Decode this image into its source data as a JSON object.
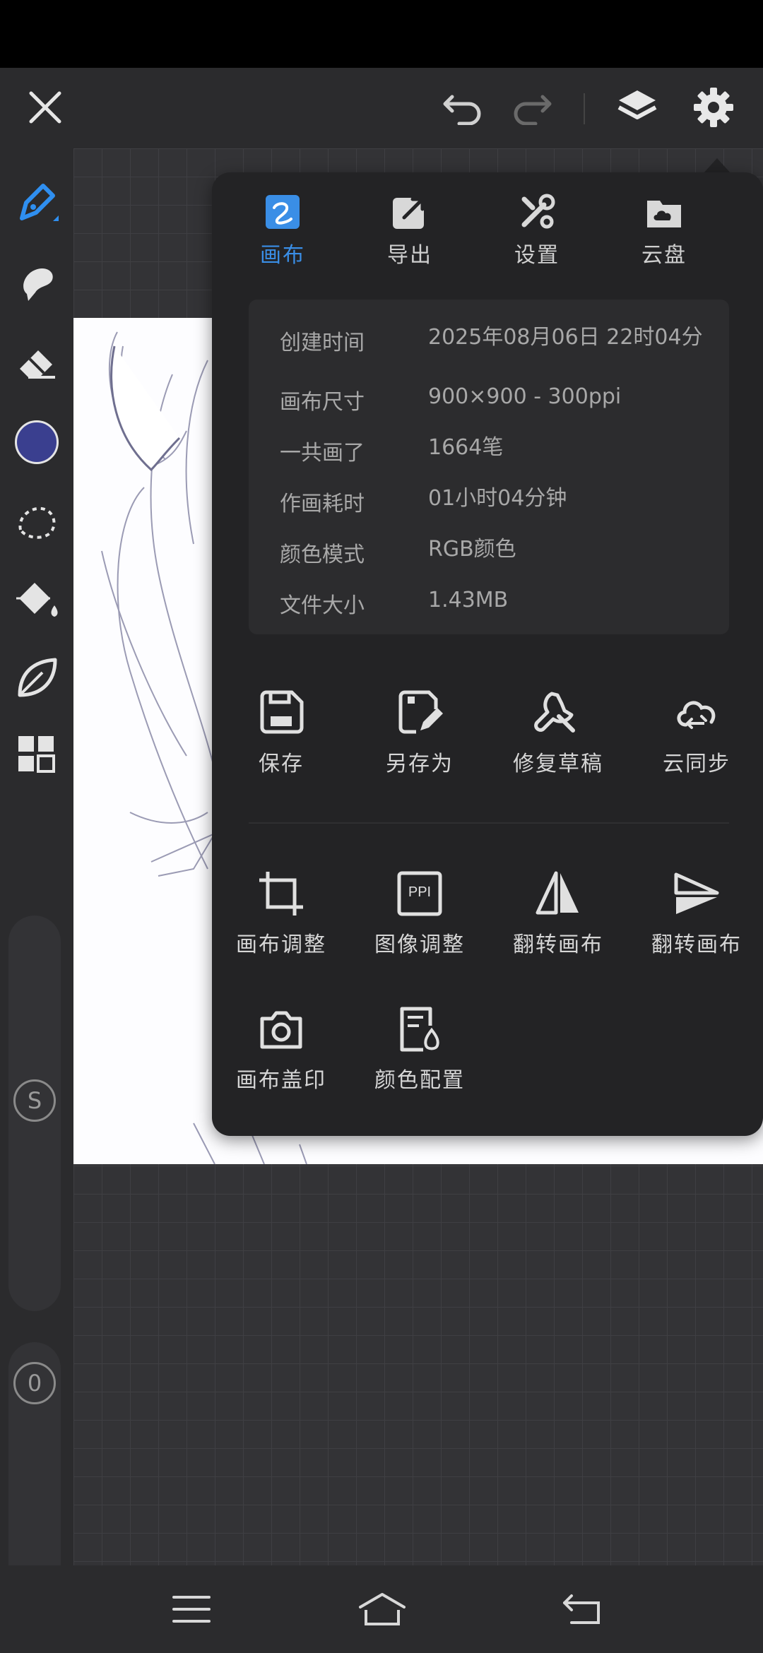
{
  "colors": {
    "accent": "#3a8ee6",
    "current_color": "#3a3f8f"
  },
  "top_bar": {
    "close_icon": "close-icon",
    "undo_icon": "undo-icon",
    "redo_icon": "redo-icon",
    "layers_icon": "layers-icon",
    "settings_icon": "gear-icon"
  },
  "left_toolbar": {
    "tools": [
      "pen-icon",
      "smudge-icon",
      "eraser-icon",
      "color-swatch",
      "lasso-icon",
      "fill-bucket-icon",
      "leaf-icon",
      "grid-menu-icon"
    ],
    "size_button": "S",
    "opacity_button": "0"
  },
  "panel": {
    "tabs": [
      {
        "label": "画布",
        "icon": "canvas-icon",
        "active": true
      },
      {
        "label": "导出",
        "icon": "export-icon",
        "active": false
      },
      {
        "label": "设置",
        "icon": "tools-icon",
        "active": false
      },
      {
        "label": "云盘",
        "icon": "cloud-folder-icon",
        "active": false
      }
    ],
    "info": [
      {
        "key": "创建时间",
        "value": "2025年08月06日 22时04分"
      },
      {
        "key": "画布尺寸",
        "value": "900×900 - 300ppi"
      },
      {
        "key": "一共画了",
        "value": "1664笔"
      },
      {
        "key": "作画耗时",
        "value": "01小时04分钟"
      },
      {
        "key": "颜色模式",
        "value": "RGB颜色"
      },
      {
        "key": "文件大小",
        "value": "1.43MB"
      }
    ],
    "actions_row1": [
      {
        "label": "保存",
        "icon": "save-icon"
      },
      {
        "label": "另存为",
        "icon": "save-as-icon"
      },
      {
        "label": "修复草稿",
        "icon": "wrench-icon"
      },
      {
        "label": "云同步",
        "icon": "cloud-sync-icon"
      }
    ],
    "actions_row2": [
      {
        "label": "画布调整",
        "icon": "crop-icon"
      },
      {
        "label": "图像调整",
        "icon": "ppi-icon",
        "badge": "PPI"
      },
      {
        "label": "翻转画布",
        "icon": "flip-horizontal-icon"
      },
      {
        "label": "翻转画布",
        "icon": "flip-vertical-icon"
      }
    ],
    "actions_row3": [
      {
        "label": "画布盖印",
        "icon": "camera-icon"
      },
      {
        "label": "颜色配置",
        "icon": "color-profile-icon"
      }
    ]
  },
  "bottom_nav": {
    "menu_icon": "menu-icon",
    "home_icon": "home-icon",
    "back_icon": "back-icon"
  }
}
